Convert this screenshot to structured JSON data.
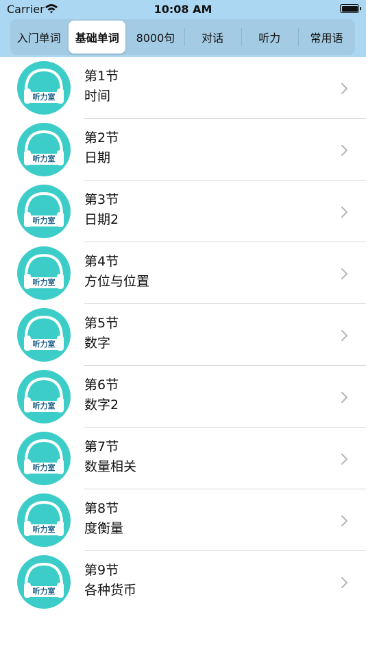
{
  "status_bar": {
    "carrier": "Carrier",
    "time": "10:08 AM"
  },
  "tabs": [
    {
      "label": "入门单词",
      "selected": false
    },
    {
      "label": "基础单词",
      "selected": true
    },
    {
      "label": "8000句",
      "selected": false
    },
    {
      "label": "对话",
      "selected": false
    },
    {
      "label": "听力",
      "selected": false
    },
    {
      "label": "常用语",
      "selected": false
    }
  ],
  "icon_badge_text": "听力室",
  "lessons": [
    {
      "section": "第1节",
      "title": "时间"
    },
    {
      "section": "第2节",
      "title": "日期"
    },
    {
      "section": "第3节",
      "title": "日期2"
    },
    {
      "section": "第4节",
      "title": "方位与位置"
    },
    {
      "section": "第5节",
      "title": "数字"
    },
    {
      "section": "第6节",
      "title": "数字2"
    },
    {
      "section": "第7节",
      "title": "数量相关"
    },
    {
      "section": "第8节",
      "title": "度衡量"
    },
    {
      "section": "第9节",
      "title": "各种货币"
    }
  ],
  "colors": {
    "header_bg": "#abd7f2",
    "segment_bg": "#a3cbe4",
    "icon_teal": "#3ccdc8"
  }
}
